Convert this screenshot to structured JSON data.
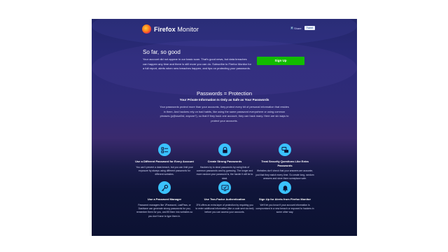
{
  "header": {
    "logo_bold": "Firefox",
    "logo_rest": " Monitor",
    "share_label": "Share",
    "tweet_label": "Tweet"
  },
  "so_far": {
    "title": "So far, so good",
    "text": "Your account did not appear in our basic scan. That's good news, but data breaches can happen any time and there is still more you can do. Subscribe to Firefox Monitor for a full report, alerts when new breaches happen, and tips on protecting your passwords.",
    "signup_label": "Sign Up"
  },
  "passwords_protection": {
    "title": "Passwords = Protection",
    "subtitle": "Your Private Information Is Only as Safe as Your Passwords",
    "text": "Your passwords protect more than your accounts, they protect every bit of personal information that resides in them. And hackers rely on bad habits, like using the same password everywhere or using common phrases (p@ssw0rd, anyone?), so that if they hack one account, they can hack many. Here are six ways to protect your accounts."
  },
  "features": [
    {
      "title": "Use a Different Password for Every Account",
      "text": "You can't prevent a data breach, but you can limit your exposure by always using different passwords for different websites.",
      "icon": "shield-list-icon"
    },
    {
      "title": "Create Strong Passwords",
      "text": "Hackers try to steal passwords by using lists of common passwords and by guessing. The longer and more random your password is, the harder it will be to steal.",
      "icon": "lock-icon"
    },
    {
      "title": "Treat Security Questions Like Extra Passwords",
      "text": "Websites don't check that your answers are accurate, just that they match every time. So create long, random answers and store them someplace safe.",
      "icon": "chat-bubbles-icon"
    },
    {
      "title": "Use a Password Manager",
      "text": "Password managers like 1Password, LastPass, or Dashlane can generate strong passwords for you, remember them for you, and fill them into websites so you don't have to type them in.",
      "icon": "key-icon"
    },
    {
      "title": "Use Two-Factor Authentication",
      "text": "2FA offers an extra layer of protection by requiring you to enter additional information (like a code sent via text) before you can access your accounts.",
      "icon": "screen-check-icon"
    },
    {
      "title": "Sign Up for Alerts from Firefox Monitor",
      "text": "We'll let you know if your account information is compromised in a new breach or exposed to hackers in some other way.",
      "icon": "bell-icon"
    }
  ],
  "colors": {
    "accent_green": "#12bc00",
    "icon_blue": "#3ac2ff",
    "background_top": "#23276b",
    "background_bottom": "#0c1232"
  }
}
